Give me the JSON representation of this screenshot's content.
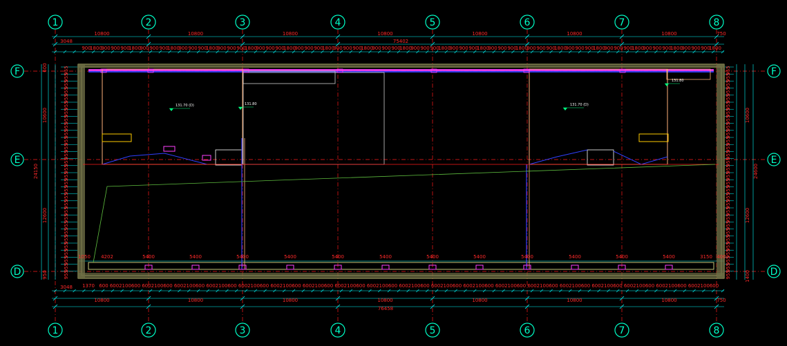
{
  "grid": {
    "columns": [
      "1",
      "2",
      "3",
      "4",
      "5",
      "6",
      "7",
      "8"
    ],
    "rows": [
      "F",
      "E",
      "D"
    ]
  },
  "dimensions": {
    "top_bays": [
      "10800",
      "10800",
      "10800",
      "10800",
      "10800",
      "10800",
      "10800"
    ],
    "top_left_offset": "3048",
    "top_total": "75402",
    "top_right_offset": "750",
    "bottom_left_offset": "3048",
    "bottom_bays": [
      "10800",
      "10800",
      "10800",
      "10800",
      "10800",
      "10800",
      "10800"
    ],
    "bottom_right_offset": "750",
    "bottom_total": "76458",
    "row_bays_left": [
      "10600",
      "12600"
    ],
    "row_total_left": "24150",
    "row_bays_right": [
      "10600",
      "12600"
    ],
    "row_total_right": "24600",
    "top_offset_left": "600",
    "bottom_offset_left": "950",
    "bottom_offset_right": "1400",
    "inner_row": [
      "4202",
      "5400",
      "5400",
      "5400",
      "5400",
      "5400",
      "5400",
      "5400",
      "5400",
      "5400",
      "5400",
      "5400",
      "5400",
      "3150"
    ],
    "inner_left_end": "1050",
    "inner_right_end": "400",
    "bottom_strip_sample": "2100",
    "bottom_strip_first": "1370"
  },
  "levels": [
    {
      "text": "131.70 (D)"
    },
    {
      "text": "131.80"
    },
    {
      "text": "131.70 (D)"
    },
    {
      "text": "131.80"
    }
  ],
  "colors": {
    "grid_circle": "#00ffc8",
    "dimension_line": "#00ffff",
    "dimension_text": "#ff2a2a",
    "axis_line": "#ff1a1a",
    "wall": "#c8c87a",
    "room_outline": "#ffb27a",
    "pipe": "#3040ff",
    "equipment": "#ff40ff",
    "green_line": "#5fbf3f"
  }
}
